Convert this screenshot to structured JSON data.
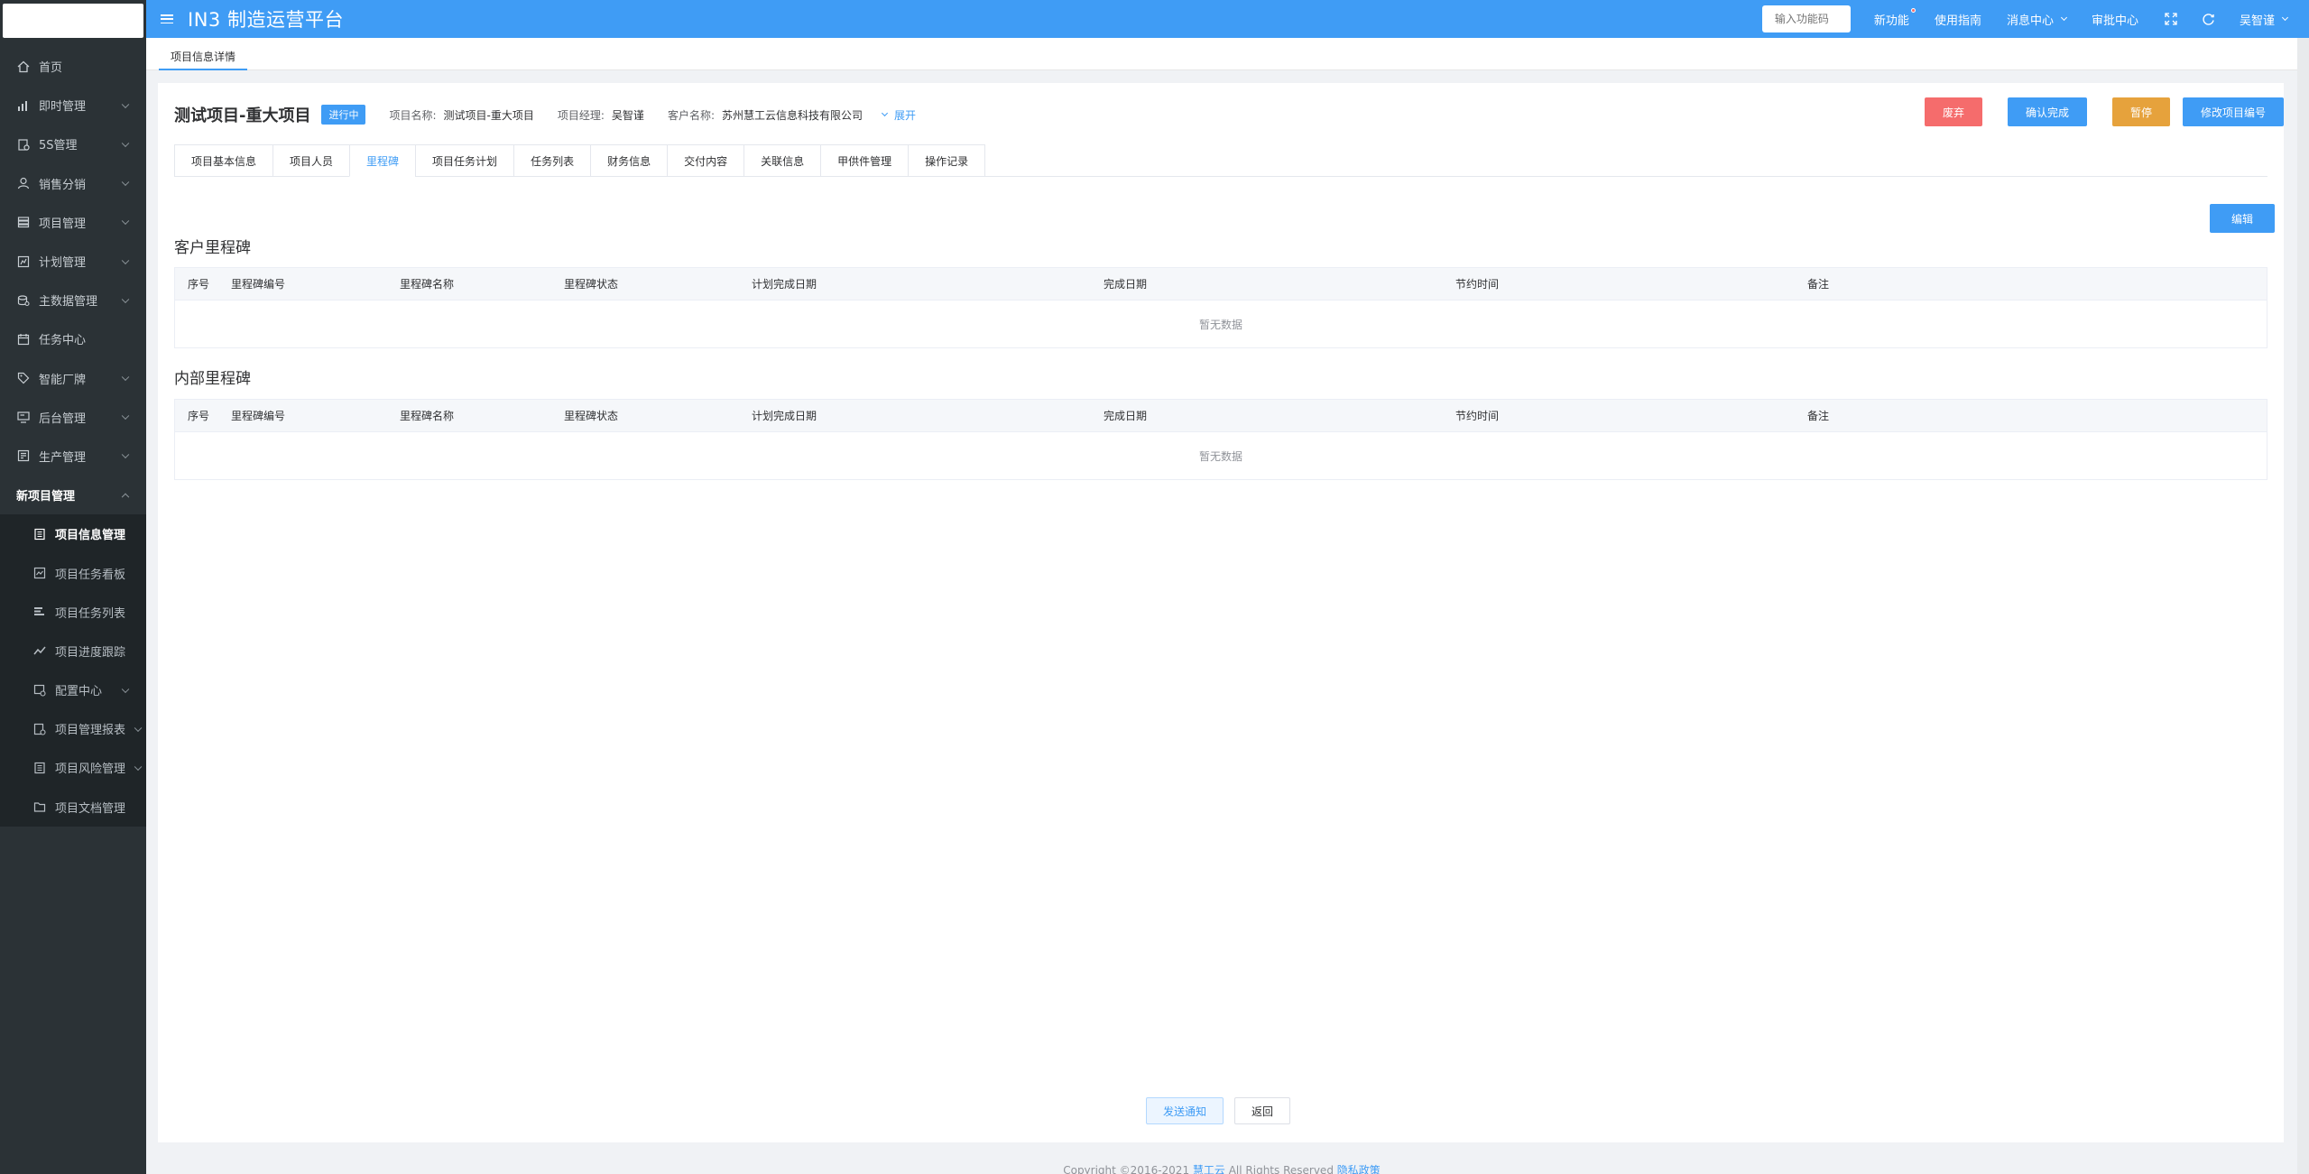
{
  "app": {
    "title": "IN3 制造运营平台"
  },
  "header": {
    "func_input_placeholder": "输入功能码",
    "links": [
      "新功能",
      "使用指南",
      "消息中心",
      "审批中心"
    ],
    "user": "吴智谨"
  },
  "sidebar": {
    "items": [
      {
        "label": "首页",
        "icon": "home-icon",
        "chevron": false
      },
      {
        "label": "即时管理",
        "icon": "bar-chart-icon",
        "chevron": true
      },
      {
        "label": "5S管理",
        "icon": "clipboard-icon",
        "chevron": true
      },
      {
        "label": "销售分销",
        "icon": "user-icon",
        "chevron": true
      },
      {
        "label": "项目管理",
        "icon": "layers-icon",
        "chevron": true
      },
      {
        "label": "计划管理",
        "icon": "plan-icon",
        "chevron": true
      },
      {
        "label": "主数据管理",
        "icon": "database-icon",
        "chevron": true
      },
      {
        "label": "任务中心",
        "icon": "calendar-icon",
        "chevron": false
      },
      {
        "label": "智能厂牌",
        "icon": "tag-icon",
        "chevron": true
      },
      {
        "label": "后台管理",
        "icon": "monitor-icon",
        "chevron": true
      },
      {
        "label": "生产管理",
        "icon": "document-icon",
        "chevron": true
      }
    ],
    "open_group": "新项目管理",
    "sub_items": [
      {
        "label": "项目信息管理",
        "icon": "file-list-icon",
        "active": true
      },
      {
        "label": "项目任务看板",
        "icon": "board-icon",
        "active": false
      },
      {
        "label": "项目任务列表",
        "icon": "list-icon",
        "active": false
      },
      {
        "label": "项目进度跟踪",
        "icon": "trend-icon",
        "active": false
      },
      {
        "label": "配置中心",
        "icon": "config-icon",
        "active": false,
        "chevron": true
      },
      {
        "label": "项目管理报表",
        "icon": "report-icon",
        "active": false,
        "chevron": true
      },
      {
        "label": "项目风险管理",
        "icon": "risk-icon",
        "active": false,
        "chevron": true
      },
      {
        "label": "项目文档管理",
        "icon": "folder-icon",
        "active": false
      }
    ]
  },
  "tagsbar": {
    "active_tag": "项目信息详情"
  },
  "project": {
    "title": "测试项目-重大项目",
    "status": "进行中",
    "name_label": "项目名称:",
    "name_value": "测试项目-重大项目",
    "manager_label": "项目经理:",
    "manager_value": "吴智谨",
    "customer_label": "客户名称:",
    "customer_value": "苏州慧工云信息科技有限公司",
    "expand_label": "展开"
  },
  "actions": {
    "discard": "废弃",
    "confirm": "确认完成",
    "pause": "暂停",
    "modify_code": "修改项目编号"
  },
  "tabs": [
    "项目基本信息",
    "项目人员",
    "里程碑",
    "项目任务计划",
    "任务列表",
    "财务信息",
    "交付内容",
    "关联信息",
    "甲供件管理",
    "操作记录"
  ],
  "active_tab": 2,
  "edit_label": "编辑",
  "customer_section": {
    "title": "客户里程碑",
    "columns": [
      "序号",
      "里程碑编号",
      "里程碑名称",
      "里程碑状态",
      "计划完成日期",
      "完成日期",
      "节约时间",
      "备注"
    ],
    "empty": "暂无数据"
  },
  "internal_section": {
    "title": "内部里程碑",
    "columns": [
      "序号",
      "里程碑编号",
      "里程碑名称",
      "里程碑状态",
      "计划完成日期",
      "完成日期",
      "节约时间",
      "备注"
    ],
    "empty": "暂无数据"
  },
  "bottom": {
    "send": "发送通知",
    "back": "返回"
  },
  "footer": {
    "copyright": "Copyright ©2016-2021 ",
    "brand": "慧工云",
    "rights": " All Rights Reserved ",
    "privacy": "隐私政策"
  }
}
